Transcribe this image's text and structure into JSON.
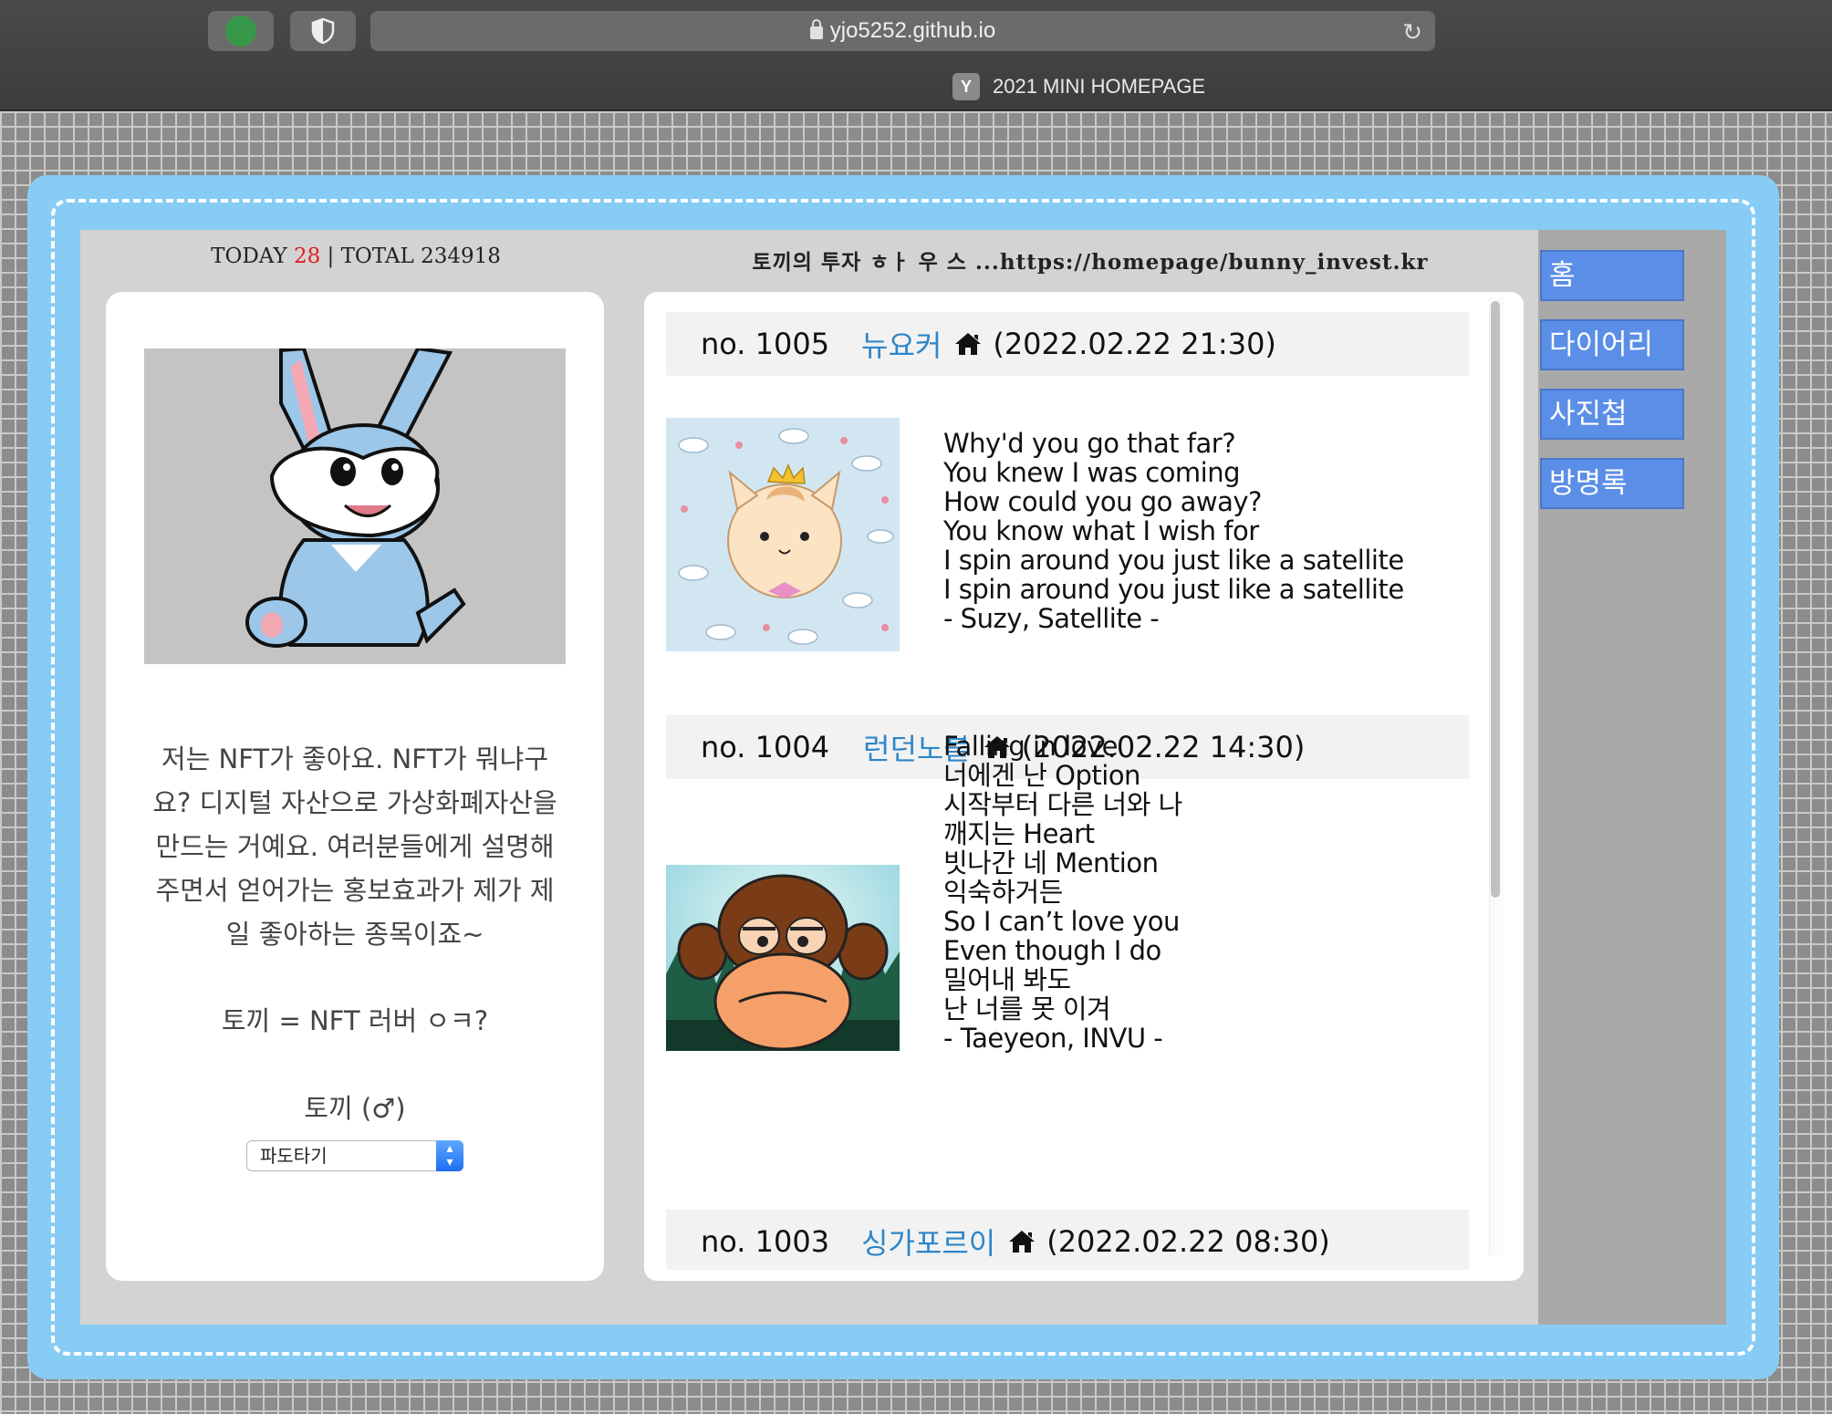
{
  "browser": {
    "url": "yjo5252.github.io",
    "tab_title": "2021 MINI HOMEPAGE",
    "tab_favicon": "Y"
  },
  "header": {
    "today_label": "TODAY",
    "today_count": "28",
    "total_label": "| TOTAL 234918",
    "site_title": "토끼의 투자 ㅎㅏ 우 스 ...https://homepage/bunny_invest.kr"
  },
  "profile": {
    "bio_lines": [
      "저는 NFT가 좋아요. NFT가 뭐냐구",
      "요? 디지털 자산으로 가상화폐자산을",
      "만드는 거예요. 여러분들에게 설명해",
      "주면서 얻어가는 홍보효과가 제가 제",
      "일 좋아하는 종목이죠~"
    ],
    "tagline": "토끼 = NFT 러버 ㅇㅋ?",
    "name": "토끼 (♂)",
    "select_value": "파도타기"
  },
  "posts": [
    {
      "no": "no. 1005",
      "author": "뉴요커",
      "date": "(2022.02.22 21:30)",
      "lines": [
        "Why'd you go that far?",
        "You knew I was coming",
        "How could you go away?",
        "You know what I wish for",
        "I spin around you just like a satellite",
        "I spin around you just like a satellite",
        "- Suzy, Satellite -"
      ]
    },
    {
      "no": "no. 1004",
      "author": "런던노블",
      "date": "(2022.02.22 14:30)",
      "lines": [
        "Falling in love",
        "너에겐 난 Option",
        "시작부터 다른 너와 나",
        "깨지는 Heart",
        "빗나간 네 Mention",
        "익숙하거든",
        "So I can’t love you",
        "Even though I do",
        "밀어내 봐도",
        "난 너를 못 이겨",
        "- Taeyeon, INVU -"
      ]
    },
    {
      "no": "no. 1003",
      "author": "싱가포르이",
      "date": "(2022.02.22 08:30)",
      "lines": []
    }
  ],
  "menu": [
    "홈",
    "다이어리",
    "사진첩",
    "방명록"
  ],
  "colors": {
    "frame": "#87ccf5",
    "menu_button": "#5b8ee6",
    "author_link": "#2d86c9",
    "today_count": "#e02020"
  }
}
